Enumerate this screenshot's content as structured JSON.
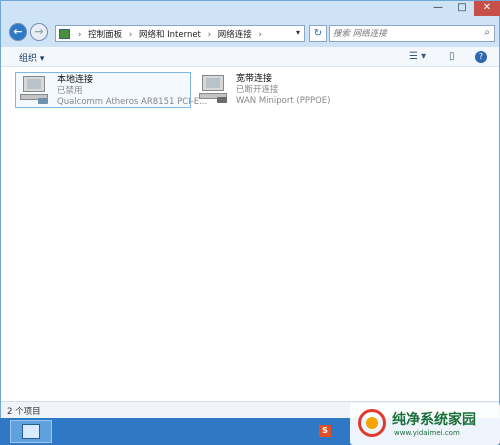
{
  "window": {
    "controls": {
      "minimize": "—",
      "maximize": "□",
      "close": "✕"
    }
  },
  "nav": {
    "back_icon": "←",
    "forward_icon": "→",
    "breadcrumbs": [
      "控制面板",
      "网络和 Internet",
      "网络连接"
    ],
    "refresh_icon": "↻",
    "search_placeholder": "搜索 网络连接",
    "search_icon": "⌕"
  },
  "toolbar": {
    "organize_label": "组织 ▾",
    "view_icon": "☰ ▾",
    "preview_icon": "▯",
    "help_icon": "?"
  },
  "connections": [
    {
      "name": "本地连接",
      "status": "已禁用",
      "device": "Qualcomm Atheros AR8151 PCI-E..."
    },
    {
      "name": "宽带连接",
      "status": "已断开连接",
      "device": "WAN Miniport (PPPOE)"
    }
  ],
  "status_bar": {
    "text": "2 个项目"
  },
  "taskbar": {
    "tray_icon_letter": "S"
  },
  "watermark": {
    "title": "纯净系统家园",
    "url": "www.yidaimei.com"
  },
  "colors": {
    "accent": "#2e78c6",
    "selection_border": "#7fb8e6",
    "close_red": "#c7504b"
  }
}
